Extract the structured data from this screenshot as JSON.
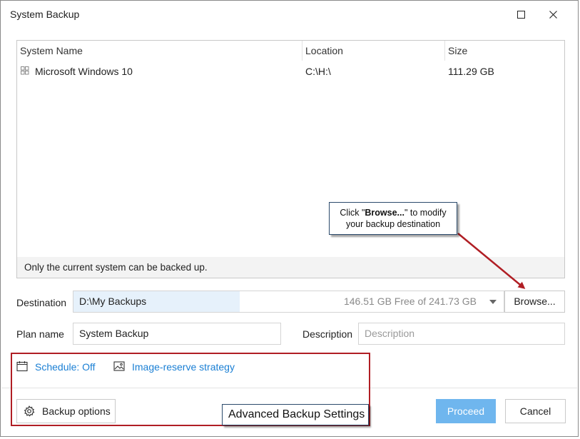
{
  "window": {
    "title": "System Backup",
    "maximize_icon": "maximize-icon",
    "close_icon": "close-icon"
  },
  "systems_list": {
    "columns": [
      "System Name",
      "Location",
      "Size"
    ],
    "rows": [
      {
        "name": "Microsoft Windows 10",
        "location": "C:\\H:\\",
        "size": "111.29 GB",
        "icon": "windows-icon"
      }
    ],
    "footer_note": "Only the current system can be backed up."
  },
  "callout_browse": {
    "prefix": "Click \"",
    "bold": "Browse...",
    "suffix": "\" to modify",
    "line2": "your backup destination"
  },
  "destination": {
    "label": "Destination",
    "path": "D:\\My Backups",
    "free_space": "146.51 GB Free of 241.73 GB",
    "browse_label": "Browse..."
  },
  "plan": {
    "label": "Plan name",
    "value": "System Backup"
  },
  "description": {
    "label": "Description",
    "placeholder": "Description",
    "value": ""
  },
  "links": {
    "schedule": "Schedule: Off",
    "image_reserve": "Image-reserve strategy"
  },
  "buttons": {
    "backup_options": "Backup options",
    "proceed": "Proceed",
    "cancel": "Cancel"
  },
  "annotation": {
    "advanced_label": "Advanced Backup Settings"
  },
  "colors": {
    "link": "#1a7fd4",
    "proceed_bg": "#6fb6ee",
    "highlight_red": "#b01e24",
    "destination_highlight": "#e6f1fb"
  }
}
